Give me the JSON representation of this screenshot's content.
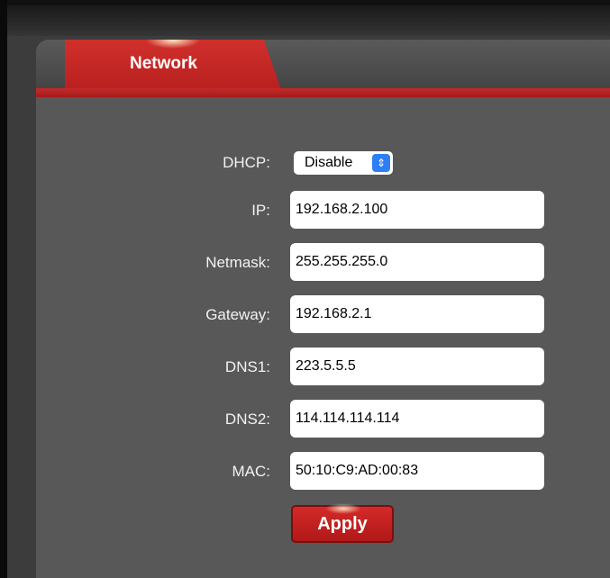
{
  "tabs": [
    {
      "label": "Network",
      "active": true
    }
  ],
  "form": {
    "dhcp": {
      "label": "DHCP:",
      "value": "Disable"
    },
    "ip": {
      "label": "IP:",
      "value": "192.168.2.100"
    },
    "netmask": {
      "label": "Netmask:",
      "value": "255.255.255.0"
    },
    "gateway": {
      "label": "Gateway:",
      "value": "192.168.2.1"
    },
    "dns1": {
      "label": "DNS1:",
      "value": "223.5.5.5"
    },
    "dns2": {
      "label": "DNS2:",
      "value": "114.114.114.114"
    },
    "mac": {
      "label": "MAC:",
      "value": "50:10:C9:AD:00:83"
    }
  },
  "apply_label": "Apply",
  "icons": {
    "select_arrow": "updown-chevron-icon"
  },
  "colors": {
    "accent_red": "#c42a27",
    "select_blue": "#2e7ff5",
    "panel_gray": "#585858"
  }
}
